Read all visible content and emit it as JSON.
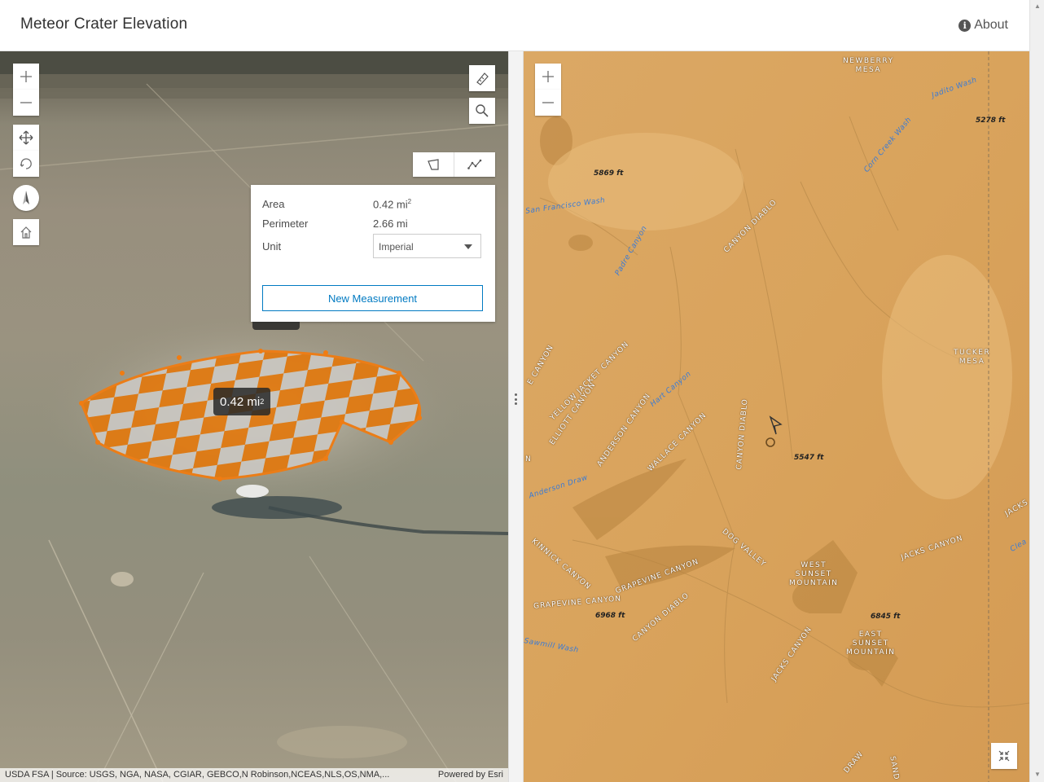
{
  "header": {
    "title": "Meteor Crater Elevation",
    "about_label": "About"
  },
  "left_view": {
    "measurement": {
      "area_label": "Area",
      "area_value": "0.42 mi",
      "perimeter_label": "Perimeter",
      "perimeter_value": "2.66 mi",
      "unit_label": "Unit",
      "unit_value": "Imperial",
      "new_button": "New Measurement"
    },
    "area_tooltip": "0.42 mi",
    "attribution": {
      "sources": "USDA FSA | Source: USGS, NGA, NASA, CGIAR, GEBCO,N Robinson,NCEAS,NLS,OS,NMA,...",
      "powered_by": "Powered by Esri"
    },
    "colors": {
      "measure_fill": "#e8861b",
      "measure_stroke": "#f07c12"
    }
  },
  "right_view": {
    "labels": {
      "newberry_mesa": "NEWBERRY\nMESA",
      "jadito_wash": "Jadito Wash",
      "elev_5278": "5278 ft",
      "corn_creek_wash": "Corn Creek Wash",
      "elev_5869": "5869 ft",
      "san_francisco_wash": "San Francisco Wash",
      "canyon_diablo_1": "CANYON DIABLO",
      "padre_canyon": "Padre Canyon",
      "tucker_mesa": "TUCKER\nMESA",
      "yellow_jacket_canyon": "YELLOW JACKET CANYON",
      "elliott_canyon": "ELLIOTT CANYON",
      "hart_canyon": "Hart Canyon",
      "anderson_canyon": "ANDERSON CANYON",
      "wallace_canyon": "WALLACE CANYON",
      "canyon_diablo_2": "CANYON DIABLO",
      "elev_5547": "5547 ft",
      "anderson_draw": "Anderson Draw",
      "dog_valley": "DOG VALLEY",
      "jacks_canyon_1": "JACKS CANYON",
      "west_sunset_mountain": "WEST\nSUNSET\nMOUNTAIN",
      "kinnick_canyon": "KINNICK CANYON",
      "grapevine_canyon_1": "GRAPEVINE CANYON",
      "grapevine_canyon_2": "GRAPEVINE CANYON",
      "elev_6968": "6968 ft",
      "canyon_diablo_3": "CANYON DIABLO",
      "elev_6845": "6845 ft",
      "east_sunset_mountain": "EAST\nSUNSET\nMOUNTAIN",
      "sawmill_wash": "Sawmill Wash",
      "jacks_canyon_2": "JACKS CANYON",
      "jacks_edge": "JACKS",
      "clear_edge": "Clea",
      "e_canyon_edge": "E CANYON",
      "draw_edge": "DRAW",
      "sand_edge": "SAND",
      "n_edge": "N"
    },
    "colors": {
      "terrain": "#d9a45e",
      "water": "#3a7bd5"
    }
  }
}
